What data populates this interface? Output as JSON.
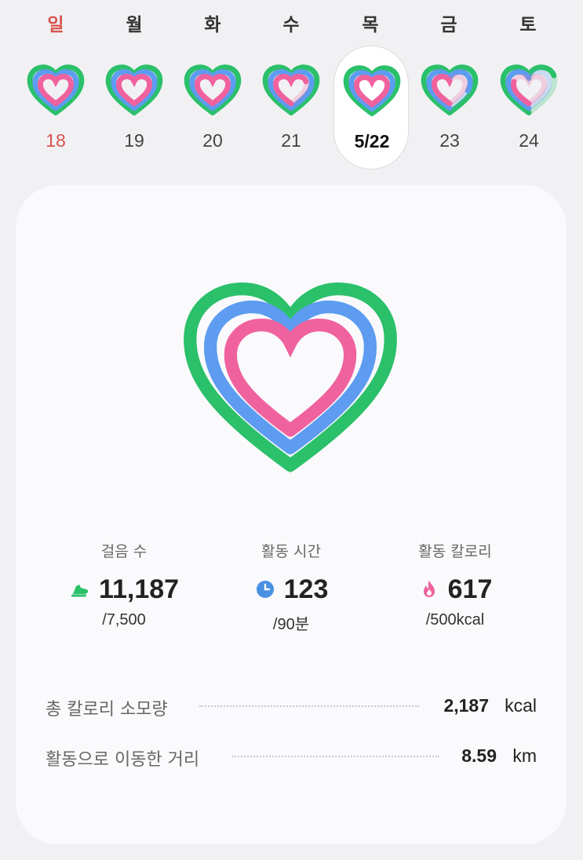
{
  "weekdays": [
    "일",
    "월",
    "화",
    "수",
    "목",
    "금",
    "토"
  ],
  "days": [
    {
      "label": "18",
      "sunday": true,
      "selected": false,
      "outer": 1.0,
      "middle": 1.0,
      "inner": 1.0
    },
    {
      "label": "19",
      "sunday": false,
      "selected": false,
      "outer": 1.0,
      "middle": 1.0,
      "inner": 1.0
    },
    {
      "label": "20",
      "sunday": false,
      "selected": false,
      "outer": 1.0,
      "middle": 1.0,
      "inner": 1.0
    },
    {
      "label": "21",
      "sunday": false,
      "selected": false,
      "outer": 1.0,
      "middle": 1.0,
      "inner": 0.7
    },
    {
      "label": "5/22",
      "sunday": false,
      "selected": true,
      "outer": 1.0,
      "middle": 1.0,
      "inner": 1.0
    },
    {
      "label": "23",
      "sunday": false,
      "selected": false,
      "outer": 1.0,
      "middle": 0.8,
      "inner": 0.5
    },
    {
      "label": "24",
      "sunday": false,
      "selected": false,
      "outer": 0.7,
      "middle": 0.5,
      "inner": 0.3
    }
  ],
  "colors": {
    "outer": "#2bc06a",
    "middle": "#5d9cf0",
    "inner": "#f0629e",
    "sunday": "#d9534f"
  },
  "stats": {
    "steps": {
      "label": "걸음 수",
      "value": "11,187",
      "goal": "/7,500",
      "icon": "shoe-icon"
    },
    "active_time": {
      "label": "활동 시간",
      "value": "123",
      "goal": "/90분",
      "icon": "clock-icon"
    },
    "active_calories": {
      "label": "활동 칼로리",
      "value": "617",
      "goal": "/500kcal",
      "icon": "flame-icon"
    }
  },
  "summary": {
    "total_calories": {
      "label": "총 칼로리 소모량",
      "value": "2,187",
      "unit": "kcal"
    },
    "distance": {
      "label": "활동으로 이동한 거리",
      "value": "8.59",
      "unit": "km"
    }
  }
}
